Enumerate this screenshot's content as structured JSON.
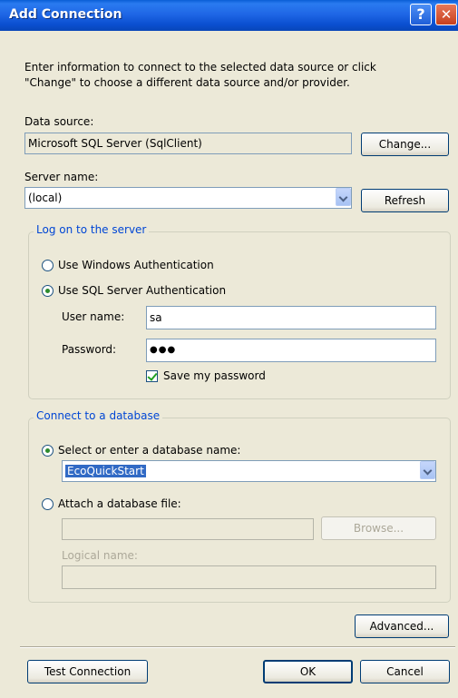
{
  "window": {
    "title": "Add Connection",
    "help_glyph": "?",
    "close_glyph": "✕"
  },
  "intro": {
    "line1": "Enter information to connect to the selected data source or click",
    "line2": "\"Change\" to choose a different data source and/or provider."
  },
  "data_source": {
    "label": "Data source:",
    "value": "Microsoft SQL Server (SqlClient)",
    "change_button": "Change..."
  },
  "server": {
    "label": "Server name:",
    "value": "(local)",
    "refresh_button": "Refresh"
  },
  "logon": {
    "legend": "Log on to the server",
    "windows_auth": "Use Windows Authentication",
    "sql_auth": "Use SQL Server Authentication",
    "selected": "sql_auth",
    "username_label": "User name:",
    "username_value": "sa",
    "password_label": "Password:",
    "password_value": "●●●",
    "save_password": "Save my password",
    "save_password_checked": true
  },
  "database": {
    "legend": "Connect to a database",
    "select_option": "Select or enter a database name:",
    "database_value": "EcoQuickStart",
    "attach_option": "Attach a database file:",
    "selected": "select_option",
    "browse_button": "Browse...",
    "logical_name_label": "Logical name:"
  },
  "buttons": {
    "advanced": "Advanced...",
    "test_connection": "Test Connection",
    "ok": "OK",
    "cancel": "Cancel"
  }
}
